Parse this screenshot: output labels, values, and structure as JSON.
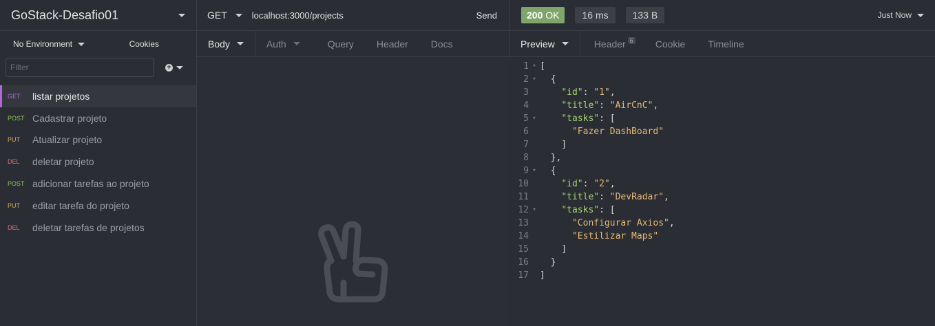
{
  "workspace": {
    "title": "GoStack-Desafio01"
  },
  "sidebar": {
    "environment": "No Environment",
    "cookies": "Cookies",
    "filter_placeholder": "Filter",
    "requests": [
      {
        "method": "GET",
        "name": "listar projetos",
        "active": true
      },
      {
        "method": "POST",
        "name": "Cadastrar projeto"
      },
      {
        "method": "PUT",
        "name": "Atualizar projeto"
      },
      {
        "method": "DEL",
        "name": "deletar projeto"
      },
      {
        "method": "POST",
        "name": "adicionar tarefas ao projeto"
      },
      {
        "method": "PUT",
        "name": "editar tarefa do projeto"
      },
      {
        "method": "DEL",
        "name": "deletar tarefas de projetos"
      }
    ]
  },
  "request": {
    "method": "GET",
    "url": "localhost:3000/projects",
    "send": "Send",
    "tabs": [
      "Body",
      "Auth",
      "Query",
      "Header",
      "Docs"
    ]
  },
  "response": {
    "status_code": "200",
    "status_text": "OK",
    "time": "16 ms",
    "size": "133 B",
    "timestamp": "Just Now",
    "tabs": [
      "Preview",
      "Header",
      "Cookie",
      "Timeline"
    ],
    "header_count": "6",
    "lines": [
      {
        "n": "1",
        "fold": true,
        "parts": [
          [
            "t",
            "["
          ]
        ]
      },
      {
        "n": "2",
        "fold": true,
        "parts": [
          [
            "t",
            "  {"
          ]
        ]
      },
      {
        "n": "3",
        "parts": [
          [
            "t",
            "    "
          ],
          [
            "k",
            "\"id\""
          ],
          [
            "t",
            ": "
          ],
          [
            "s",
            "\"1\""
          ],
          [
            "t",
            ","
          ]
        ]
      },
      {
        "n": "4",
        "parts": [
          [
            "t",
            "    "
          ],
          [
            "k",
            "\"title\""
          ],
          [
            "t",
            ": "
          ],
          [
            "s",
            "\"AirCnC\""
          ],
          [
            "t",
            ","
          ]
        ]
      },
      {
        "n": "5",
        "fold": true,
        "parts": [
          [
            "t",
            "    "
          ],
          [
            "k",
            "\"tasks\""
          ],
          [
            "t",
            ": ["
          ]
        ]
      },
      {
        "n": "6",
        "parts": [
          [
            "t",
            "      "
          ],
          [
            "s",
            "\"Fazer DashBoard\""
          ]
        ]
      },
      {
        "n": "7",
        "parts": [
          [
            "t",
            "    ]"
          ]
        ]
      },
      {
        "n": "8",
        "parts": [
          [
            "t",
            "  },"
          ]
        ]
      },
      {
        "n": "9",
        "fold": true,
        "parts": [
          [
            "t",
            "  {"
          ]
        ]
      },
      {
        "n": "10",
        "parts": [
          [
            "t",
            "    "
          ],
          [
            "k",
            "\"id\""
          ],
          [
            "t",
            ": "
          ],
          [
            "s",
            "\"2\""
          ],
          [
            "t",
            ","
          ]
        ]
      },
      {
        "n": "11",
        "parts": [
          [
            "t",
            "    "
          ],
          [
            "k",
            "\"title\""
          ],
          [
            "t",
            ": "
          ],
          [
            "s",
            "\"DevRadar\""
          ],
          [
            "t",
            ","
          ]
        ]
      },
      {
        "n": "12",
        "fold": true,
        "parts": [
          [
            "t",
            "    "
          ],
          [
            "k",
            "\"tasks\""
          ],
          [
            "t",
            ": ["
          ]
        ]
      },
      {
        "n": "13",
        "parts": [
          [
            "t",
            "      "
          ],
          [
            "s",
            "\"Configurar Axios\""
          ],
          [
            "t",
            ","
          ]
        ]
      },
      {
        "n": "14",
        "parts": [
          [
            "t",
            "      "
          ],
          [
            "s",
            "\"Estilizar Maps\""
          ]
        ]
      },
      {
        "n": "15",
        "parts": [
          [
            "t",
            "    ]"
          ]
        ]
      },
      {
        "n": "16",
        "parts": [
          [
            "t",
            "  }"
          ]
        ]
      },
      {
        "n": "17",
        "parts": [
          [
            "t",
            "]"
          ]
        ]
      }
    ]
  },
  "colors": {
    "accent_get": "#b467d8",
    "post": "#8fc25e",
    "put": "#e0a84a",
    "del": "#e07474",
    "ok_badge": "#7fa56a"
  },
  "icons": {
    "empty_state": "peace-hand-icon"
  }
}
